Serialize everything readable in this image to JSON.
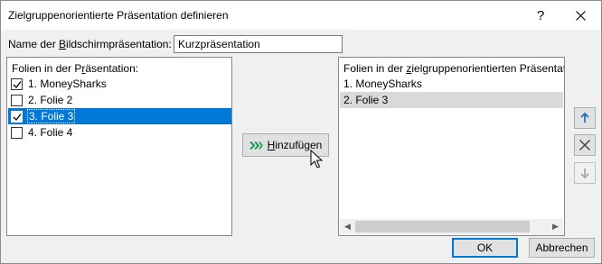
{
  "window": {
    "title": "Zielgruppenorientierte Präsentation definieren",
    "help_label": "?",
    "close_icon": "close-icon"
  },
  "name_field": {
    "label_pre": "Name der ",
    "label_ul": "B",
    "label_post": "ildschirmpräsentation:",
    "value": "Kurzpräsentation"
  },
  "left_list": {
    "header_pre": "Folien in der P",
    "header_ul": "r",
    "header_post": "äsentation:",
    "items": [
      {
        "label": "1. MoneySharks",
        "checked": true,
        "selected": false
      },
      {
        "label": "2. Folie 2",
        "checked": false,
        "selected": false
      },
      {
        "label": "3. Folie 3",
        "checked": true,
        "selected": true
      },
      {
        "label": "4. Folie 4",
        "checked": false,
        "selected": false
      }
    ]
  },
  "right_list": {
    "header_pre": "Folien in der ",
    "header_ul": "z",
    "header_post": "ielgruppenorientierten Präsentat",
    "items": [
      {
        "label": "1. MoneySharks",
        "highlighted": false
      },
      {
        "label": "2. Folie 3",
        "highlighted": true
      }
    ]
  },
  "add_button": {
    "ul": "H",
    "rest": "inzufügen",
    "icon": "double-chevron-right-icon"
  },
  "side_buttons": {
    "up_icon": "arrow-up-icon",
    "delete_icon": "delete-x-icon",
    "down_icon": "arrow-down-icon"
  },
  "footer": {
    "ok_label": "OK",
    "cancel_label": "Abbrechen"
  },
  "colors": {
    "selection": "#0078d7",
    "accent_green": "#1e9e5a",
    "arrow_blue": "#1e73be"
  }
}
